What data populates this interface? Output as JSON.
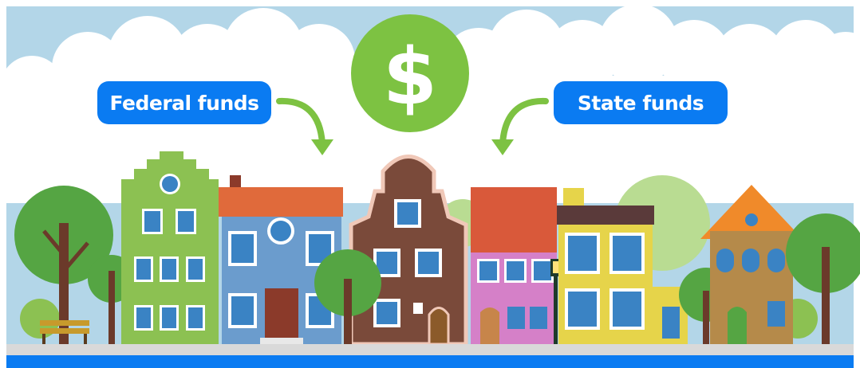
{
  "labels": {
    "federal": "Federal funds",
    "state": "State funds"
  },
  "icons": {
    "currency": "dollar-sign-icon",
    "arrow_left": "curved-arrow-down-icon",
    "arrow_right": "curved-arrow-down-icon"
  },
  "colors": {
    "sky": "#b3d6e8",
    "cloud": "#ffffff",
    "label_bg": "#0a7bf2",
    "dollar_circle": "#7dc242",
    "arrow": "#7dc242",
    "street": "#d9d9d9",
    "water": "#0a7bf2"
  }
}
